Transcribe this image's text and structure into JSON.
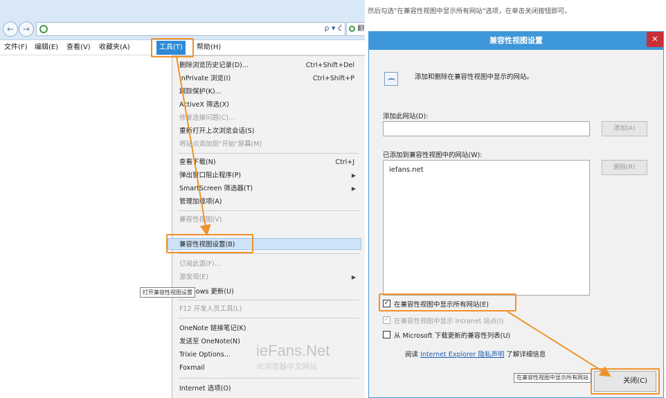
{
  "ie": {
    "nav_back_glyph": "←",
    "nav_forward_glyph": "→",
    "address_tools": "ρ ▾ ć",
    "tab_glyph": "翻",
    "menubar": [
      {
        "id": "file",
        "label": "文件(F)"
      },
      {
        "id": "edit",
        "label": "编辑(E)"
      },
      {
        "id": "view",
        "label": "查看(V)"
      },
      {
        "id": "favorites",
        "label": "收藏夹(A)"
      },
      {
        "id": "tools",
        "label": "工具(T)"
      },
      {
        "id": "help",
        "label": "帮助(H)"
      }
    ],
    "tools_menu": {
      "delete_history": {
        "label": "删除浏览历史记录(D)...",
        "shortcut": "Ctrl+Shift+Del"
      },
      "inprivate": {
        "label": "InPrivate 浏览(I)",
        "shortcut": "Ctrl+Shift+P"
      },
      "tracking_protection": {
        "label": "跟踪保护(K)..."
      },
      "activex_filtering": {
        "label": "ActiveX 筛选(X)"
      },
      "fix_connection": {
        "label": "修复连接问题(C)..."
      },
      "reopen_session": {
        "label": "重新打开上次浏览会话(S)"
      },
      "add_to_start": {
        "label": "将站点添加到\"开始\"屏幕(M)"
      },
      "view_downloads": {
        "label": "查看下载(N)",
        "shortcut": "Ctrl+J"
      },
      "popup_blocker": {
        "label": "弹出窗口阻止程序(P)"
      },
      "smartscreen": {
        "label": "SmartScreen 筛选器(T)"
      },
      "manage_addons": {
        "label": "管理加载项(A)"
      },
      "compat_view": {
        "label": "兼容性视图(V)"
      },
      "compat_view_settings": {
        "label": "兼容性视图设置(B)"
      },
      "subscribe_feed": {
        "label": "订阅此源(F)..."
      },
      "feed_discovery": {
        "label": "源发现(E)"
      },
      "windows_update": {
        "label": "Windows 更新(U)"
      },
      "f12_tools": {
        "label": "F12 开发人员工具(L)"
      },
      "onenote_linked": {
        "label": "OneNote 链接笔记(K)"
      },
      "send_to_onenote": {
        "label": "发送至 OneNote(N)"
      },
      "trixie_options": {
        "label": "Trixie Options..."
      },
      "foxmail": {
        "label": "Foxmail"
      },
      "internet_options": {
        "label": "Internet 选项(O)"
      }
    },
    "tooltip": "打开兼容性视图设置",
    "watermark": {
      "brand": "ieFans.Net",
      "tagline": "IE浏览器中文网站"
    }
  },
  "instruction": "然后勾选\"在兼容性视图中显示所有网站\"选项，在单击关闭按钮即可。",
  "dialog": {
    "title": "兼容性视图设置",
    "close_glyph": "✕",
    "intro": "添加和删除在兼容性视图中显示的网站。",
    "add_site_label": "添加此网站(D):",
    "add_site_value": "",
    "add_button": "添加(A)",
    "list_label": "已添加到兼容性视图中的网站(W):",
    "sites": [
      "iefans.net"
    ],
    "remove_button": "删除(R)",
    "check_all": {
      "label": "在兼容性视图中显示所有网站(E)",
      "checked": true,
      "mark": "✓"
    },
    "check_intranet": {
      "label": "在兼容性视图中显示 Intranet 站点(I)",
      "checked": true,
      "mark": "✓"
    },
    "check_download": {
      "label": "从 Microsoft 下载更新的兼容性列表(U)",
      "checked": false,
      "mark": ""
    },
    "link_prefix": "阅读",
    "link_text": "Internet Explorer 隐私声明",
    "link_suffix": "了解详细信息",
    "close_button": "关闭(C)",
    "tooltip": "在兼容性视图中显示所有网站"
  },
  "colors": {
    "highlight_box": "#f0922b",
    "menu_active": "#2f8ad6",
    "dialog_titlebar": "#3e97d8",
    "dialog_close": "#c7303a"
  }
}
